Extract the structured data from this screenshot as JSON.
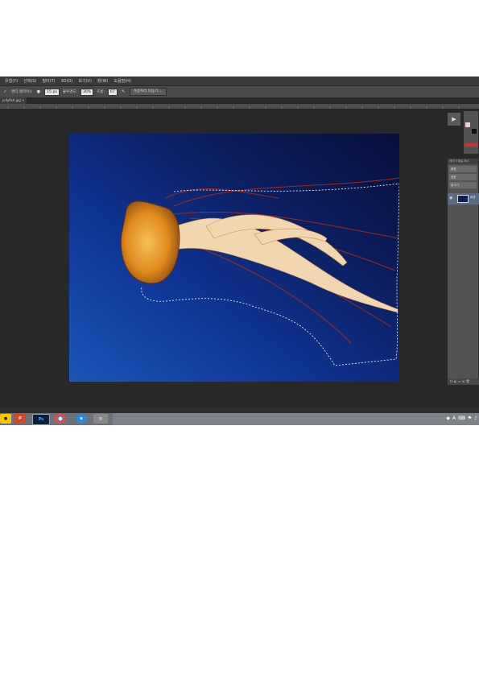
{
  "menu": [
    "유형(Y)",
    "선택(S)",
    "필터(T)",
    "3D(D)",
    "보기(V)",
    "창(W)",
    "도움말(H)"
  ],
  "options": {
    "antialias_label": "앤티 앨리어스",
    "size_icon": "brush-size-icon",
    "size_value": "15 px",
    "opacity_label": "불투명도:",
    "opacity_value": "30%",
    "flow_label": "흐름:",
    "flow_value": "67",
    "refine_button": "가장자리 다듬기 ..."
  },
  "document": {
    "tab_label": "jellyfish.jpg ×"
  },
  "layers_panel": {
    "tabs": "레이어  채널  패스",
    "kind_filter": "종류",
    "blend_mode": "표준",
    "lock_label": "잠그기:",
    "layer_name": "배경"
  },
  "taskbar": {
    "apps": [
      "kakao",
      "powerpoint",
      "photoshop",
      "chrome",
      "internet-explorer",
      "chrome-alt"
    ],
    "ps_label": "Ps",
    "tray_text": "A"
  },
  "colors": {
    "app_bg": "#282828",
    "canvas_blue": "#0e2a7a",
    "jelly_orange": "#e08a1e"
  }
}
